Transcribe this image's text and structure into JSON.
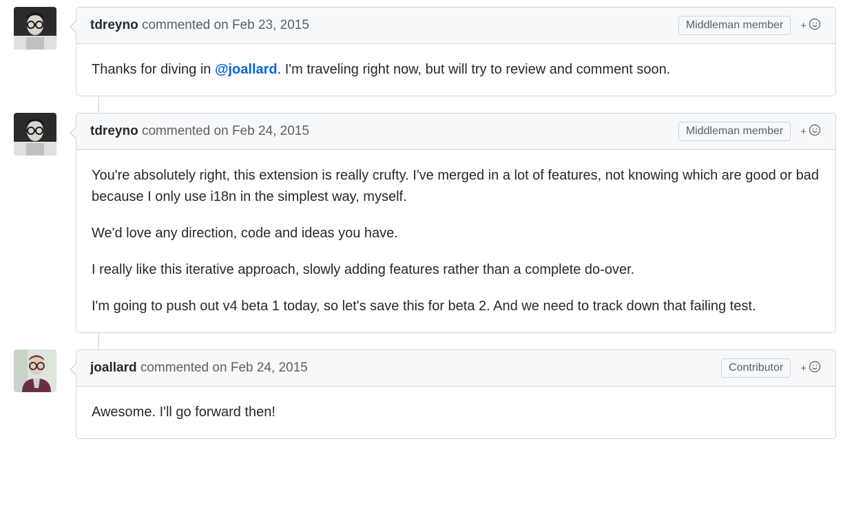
{
  "comments": [
    {
      "author": "tdreyno",
      "commented_label": "commented",
      "date_prefix": "on",
      "date": "Feb 23, 2015",
      "badge": "Middleman member",
      "avatar_variant": "bw",
      "body": [
        {
          "parts": [
            {
              "text": "Thanks for diving in "
            },
            {
              "mention": "@joallard"
            },
            {
              "text": ". I'm traveling right now, but will try to review and comment soon."
            }
          ]
        }
      ]
    },
    {
      "author": "tdreyno",
      "commented_label": "commented",
      "date_prefix": "on",
      "date": "Feb 24, 2015",
      "badge": "Middleman member",
      "avatar_variant": "bw",
      "body": [
        {
          "parts": [
            {
              "text": "You're absolutely right, this extension is really crufty. I've merged in a lot of features, not knowing which are good or bad because I only use i18n in the simplest way, myself."
            }
          ]
        },
        {
          "parts": [
            {
              "text": "We'd love any direction, code and ideas you have."
            }
          ]
        },
        {
          "parts": [
            {
              "text": "I really like this iterative approach, slowly adding features rather than a complete do-over."
            }
          ]
        },
        {
          "parts": [
            {
              "text": "I'm going to push out v4 beta 1 today, so let's save this for beta 2. And we need to track down that failing test."
            }
          ]
        }
      ]
    },
    {
      "author": "joallard",
      "commented_label": "commented",
      "date_prefix": "on",
      "date": "Feb 24, 2015",
      "badge": "Contributor",
      "avatar_variant": "color",
      "body": [
        {
          "parts": [
            {
              "text": "Awesome. I'll go forward then!"
            }
          ]
        }
      ]
    }
  ],
  "icons": {
    "reaction_plus": "+"
  }
}
